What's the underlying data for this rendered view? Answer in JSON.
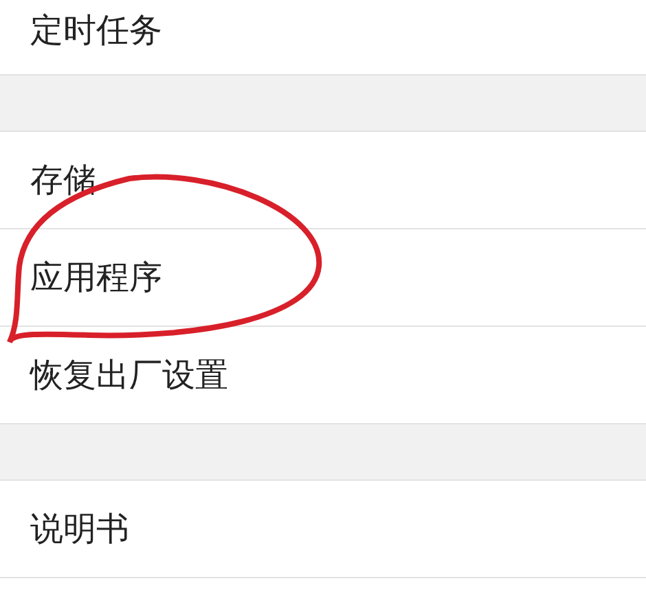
{
  "groups": [
    {
      "items": [
        {
          "label": "定时任务"
        }
      ]
    },
    {
      "items": [
        {
          "label": "存储"
        },
        {
          "label": "应用程序"
        },
        {
          "label": "恢复出厂设置"
        }
      ]
    },
    {
      "items": [
        {
          "label": "说明书"
        }
      ]
    }
  ]
}
